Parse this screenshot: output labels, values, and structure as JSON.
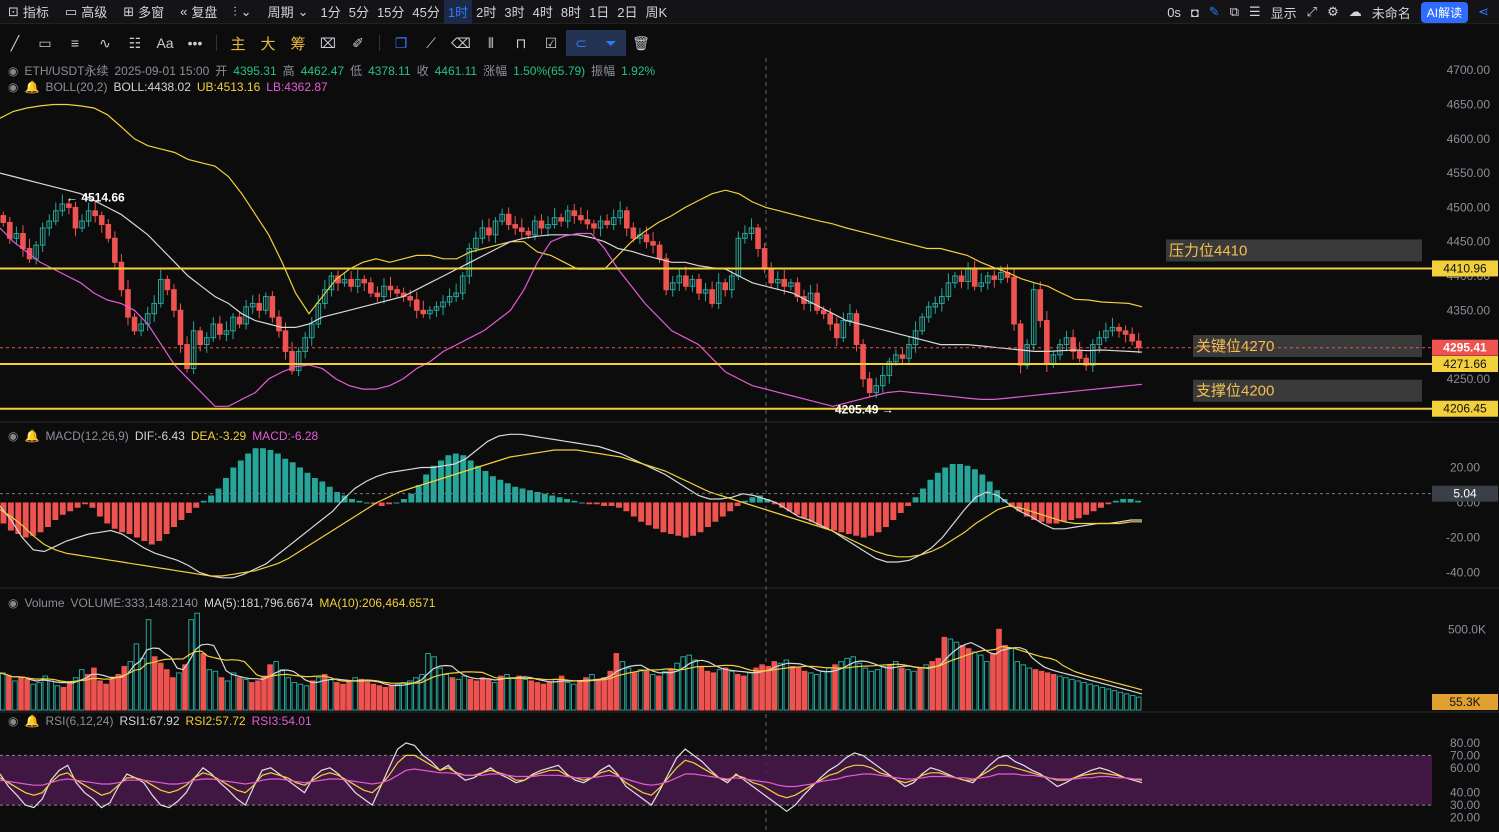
{
  "toolbar": {
    "indicators": "指标",
    "advanced": "高级",
    "multi_window": "多窗",
    "replay": "复盘",
    "period": "周期",
    "intervals": [
      "1分",
      "5分",
      "15分",
      "45分",
      "1时",
      "2时",
      "3时",
      "4时",
      "8时",
      "1日",
      "2日",
      "周K"
    ],
    "active_interval": "1时",
    "countdown": "0s",
    "display": "显示",
    "unnamed": "未命名",
    "ai_button": "AI解读"
  },
  "draw_tools": {
    "text_tool": "Aa",
    "more": "•••",
    "main": "主",
    "big": "大",
    "chips": "筹"
  },
  "legend": {
    "symbol": "ETH/USDT永续",
    "datetime": "2025-09-01 15:00",
    "open_label": "开",
    "open": "4395.31",
    "high_label": "高",
    "high": "4462.47",
    "low_label": "低",
    "low": "4378.11",
    "close_label": "收",
    "close": "4461.11",
    "change_label": "涨幅",
    "change": "1.50%(65.79)",
    "amp_label": "振幅",
    "amp": "1.92%",
    "boll_name": "BOLL(20,2)",
    "boll_mid": "BOLL:4438.02",
    "boll_ub": "UB:4513.16",
    "boll_lb": "LB:4362.87",
    "macd_name": "MACD(12,26,9)",
    "dif": "DIF:-6.43",
    "dea": "DEA:-3.29",
    "macd_val": "MACD:-6.28",
    "vol_name": "Volume",
    "vol_val": "VOLUME:333,148.2140",
    "vol_ma5": "MA(5):181,796.6674",
    "vol_ma10": "MA(10):206,464.6571",
    "rsi_name": "RSI(6,12,24)",
    "rsi1": "RSI1:67.92",
    "rsi2": "RSI2:57.72",
    "rsi3": "RSI3:54.01"
  },
  "colors": {
    "up": "#26a69a",
    "down": "#ef5350",
    "boll_mid": "#d8d8d8",
    "boll_ub": "#f2d03b",
    "boll_lb": "#e55bd4",
    "level_line": "#f2d03b",
    "rsi_band": "#4a1a4d"
  },
  "chart_data": {
    "type": "candlestick",
    "x_axis": "time (1h candles)",
    "price_axis": {
      "ticks": [
        4250,
        4300,
        4350,
        4400,
        4450,
        4500,
        4550,
        4600,
        4650,
        4700
      ],
      "tick_labels": [
        "4250.00",
        "4300.00",
        "4350.00",
        "4400.00",
        "4450.00",
        "4500.00",
        "4550.00",
        "4600.00",
        "4650.00",
        "4700.00"
      ]
    },
    "price_extremes": {
      "high": 4514.66,
      "high_label": "4514.66",
      "low": 4205.49,
      "low_label": "4205.49"
    },
    "last_price": 4295.41,
    "last_price_label": "4295.41",
    "level_labels": {
      "resistance": "4410.96",
      "key": "4271.66",
      "support": "4206.45"
    },
    "annotations": [
      {
        "text": "压力位4410",
        "price": 4410.96
      },
      {
        "text": "关键位4270",
        "price": 4271.66
      },
      {
        "text": "支撑位4200",
        "price": 4206.45
      }
    ],
    "close": [
      4478,
      4455,
      4462,
      4440,
      4425,
      4445,
      4470,
      4480,
      4495,
      4505,
      4500,
      4470,
      4480,
      4495,
      4488,
      4475,
      4455,
      4420,
      4380,
      4340,
      4320,
      4330,
      4345,
      4360,
      4395,
      4380,
      4350,
      4300,
      4265,
      4320,
      4300,
      4310,
      4330,
      4315,
      4320,
      4340,
      4330,
      4355,
      4360,
      4350,
      4370,
      4340,
      4320,
      4290,
      4262,
      4290,
      4310,
      4330,
      4360,
      4380,
      4400,
      4390,
      4395,
      4385,
      4395,
      4390,
      4375,
      4370,
      4385,
      4380,
      4375,
      4370,
      4365,
      4350,
      4345,
      4350,
      4355,
      4362,
      4370,
      4375,
      4400,
      4440,
      4455,
      4470,
      4460,
      4480,
      4490,
      4475,
      4470,
      4465,
      4460,
      4480,
      4470,
      4475,
      4485,
      4480,
      4495,
      4488,
      4482,
      4476,
      4470,
      4480,
      4475,
      4485,
      4495,
      4470,
      4455,
      4460,
      4450,
      4445,
      4425,
      4380,
      4390,
      4400,
      4385,
      4395,
      4375,
      4380,
      4360,
      4390,
      4380,
      4400,
      4455,
      4462,
      4470,
      4440,
      4410,
      4390,
      4395,
      4385,
      4390,
      4370,
      4360,
      4375,
      4350,
      4345,
      4330,
      4310,
      4335,
      4345,
      4300,
      4250,
      4230,
      4240,
      4255,
      4275,
      4285,
      4280,
      4300,
      4320,
      4340,
      4355,
      4360,
      4370,
      4390,
      4400,
      4392,
      4410,
      4385,
      4390,
      4400,
      4395,
      4405,
      4398,
      4330,
      4270,
      4300,
      4380,
      4335,
      4272,
      4285,
      4300,
      4310,
      4290,
      4280,
      4270,
      4300,
      4310,
      4320,
      4325,
      4320,
      4315,
      4305,
      4295.41
    ],
    "boll": {
      "ub": [
        4630,
        4640,
        4645,
        4648,
        4650,
        4650,
        4648,
        4645,
        4635,
        4618,
        4600,
        4590,
        4585,
        4580,
        4570,
        4565,
        4560,
        4545,
        4520,
        4490,
        4460,
        4420,
        4375,
        4345,
        4370,
        4395,
        4410,
        4420,
        4425,
        4420,
        4425,
        4430,
        4430,
        4425,
        4425,
        4435,
        4440,
        4445,
        4450,
        4450,
        4435,
        4430,
        4420,
        4410,
        4410,
        4410,
        4430,
        4450,
        4465,
        4478,
        4488,
        4500,
        4510,
        4520,
        4525,
        4520,
        4508,
        4500,
        4495,
        4490,
        4485,
        4480,
        4476,
        4470,
        4465,
        4460,
        4455,
        4450,
        4445,
        4440,
        4440,
        4435,
        4430,
        4420,
        4412,
        4405,
        4396,
        4390,
        4385,
        4375,
        4366,
        4365,
        4362,
        4361,
        4360,
        4355
      ],
      "mid": [
        4550,
        4545,
        4540,
        4535,
        4530,
        4525,
        4520,
        4510,
        4500,
        4490,
        4475,
        4460,
        4440,
        4420,
        4400,
        4385,
        4370,
        4360,
        4345,
        4335,
        4330,
        4325,
        4325,
        4330,
        4340,
        4345,
        4350,
        4355,
        4360,
        4365,
        4370,
        4380,
        4390,
        4400,
        4410,
        4420,
        4430,
        4440,
        4450,
        4455,
        4458,
        4460,
        4460,
        4460,
        4456,
        4450,
        4440,
        4436,
        4430,
        4425,
        4420,
        4420,
        4415,
        4412,
        4410,
        4400,
        4390,
        4385,
        4380,
        4375,
        4365,
        4355,
        4345,
        4335,
        4330,
        4325,
        4320,
        4315,
        4310,
        4305,
        4300,
        4300,
        4300,
        4298,
        4296,
        4294,
        4292,
        4290,
        4290,
        4291,
        4292,
        4291,
        4292,
        4291,
        4290,
        4289
      ],
      "lb": [
        4470,
        4450,
        4435,
        4420,
        4410,
        4400,
        4390,
        4375,
        4365,
        4360,
        4350,
        4330,
        4300,
        4270,
        4250,
        4230,
        4210,
        4210,
        4220,
        4230,
        4250,
        4260,
        4268,
        4270,
        4265,
        4250,
        4240,
        4235,
        4235,
        4240,
        4250,
        4265,
        4275,
        4290,
        4300,
        4310,
        4320,
        4335,
        4350,
        4380,
        4420,
        4450,
        4458,
        4462,
        4462,
        4440,
        4410,
        4385,
        4360,
        4340,
        4320,
        4310,
        4300,
        4280,
        4260,
        4250,
        4240,
        4235,
        4230,
        4225,
        4220,
        4215,
        4210,
        4215,
        4220,
        4225,
        4230,
        4232,
        4230,
        4228,
        4226,
        4224,
        4222,
        4220,
        4220,
        4222,
        4224,
        4226,
        4228,
        4230,
        4232,
        4234,
        4236,
        4238,
        4240,
        4242
      ]
    },
    "macd_axis": {
      "ticks": [
        20,
        0,
        -20,
        -40
      ],
      "tick_labels": [
        "20.00",
        "0.00",
        "-20.00",
        "-40.00"
      ],
      "current": 5.04,
      "current_label": "5.04"
    },
    "macd_hist": [
      -12,
      -16,
      -18,
      -20,
      -19,
      -17,
      -14,
      -10,
      -7,
      -5,
      -3,
      -1,
      -3,
      -8,
      -12,
      -15,
      -17,
      -18,
      -20,
      -22,
      -24,
      -22,
      -18,
      -14,
      -10,
      -6,
      -3,
      1,
      4,
      8,
      14,
      20,
      24,
      28,
      31,
      31,
      30,
      28,
      25,
      23,
      20,
      17,
      14,
      12,
      9,
      6,
      4,
      2,
      1,
      0,
      -1,
      -2,
      -1,
      0,
      2,
      5,
      10,
      16,
      21,
      24,
      27,
      28,
      27,
      24,
      21,
      18,
      15,
      13,
      11,
      9,
      8,
      7,
      6,
      5,
      4,
      3,
      2,
      1,
      0,
      -1,
      -1,
      -2,
      -2,
      -3,
      -5,
      -8,
      -11,
      -13,
      -15,
      -17,
      -18,
      -19,
      -20,
      -19,
      -17,
      -14,
      -11,
      -8,
      -5,
      -2,
      1,
      3,
      4,
      2,
      -1,
      -3,
      -5,
      -7,
      -9,
      -11,
      -13,
      -15,
      -16,
      -17,
      -18,
      -19,
      -20,
      -19,
      -17,
      -14,
      -10,
      -6,
      -2,
      3,
      8,
      13,
      17,
      20,
      22,
      22,
      21,
      19,
      16,
      12,
      7,
      2,
      -2,
      -5,
      -8,
      -10,
      -11,
      -12,
      -12,
      -11,
      -10,
      -9,
      -7,
      -5,
      -3,
      -1,
      1,
      2,
      2,
      1
    ],
    "macd_dif": [
      -2,
      -10,
      -20,
      -27,
      -28,
      -25,
      -22,
      -20,
      -18,
      -17,
      -16,
      -18,
      -22,
      -26,
      -29,
      -31,
      -33,
      -36,
      -40,
      -42,
      -43,
      -43,
      -41,
      -38,
      -35,
      -30,
      -25,
      -20,
      -15,
      -10,
      -5,
      2,
      8,
      12,
      15,
      17,
      18,
      19,
      20,
      20,
      21,
      22,
      25,
      30,
      35,
      38,
      39,
      39,
      38,
      37,
      36,
      35,
      34,
      33,
      32,
      30,
      28,
      25,
      22,
      19,
      16,
      12,
      8,
      4,
      2,
      2,
      3,
      5,
      4,
      2,
      0,
      -4,
      -8,
      -10,
      -13,
      -16,
      -20,
      -24,
      -28,
      -32,
      -34,
      -34,
      -33,
      -30,
      -26,
      -20,
      -12,
      -4,
      3,
      6,
      4,
      -1,
      -5,
      -8,
      -12,
      -15,
      -15,
      -14,
      -13,
      -12,
      -12,
      -11,
      -10,
      -10
    ],
    "macd_dea": [
      -4,
      -8,
      -13,
      -19,
      -24,
      -27,
      -29,
      -30,
      -31,
      -32,
      -33,
      -34,
      -35,
      -36,
      -37,
      -38,
      -39,
      -40,
      -41,
      -42,
      -42,
      -41,
      -40,
      -39,
      -37,
      -35,
      -32,
      -28,
      -24,
      -20,
      -16,
      -12,
      -8,
      -4,
      0,
      3,
      6,
      8,
      10,
      12,
      14,
      16,
      18,
      20,
      22,
      24,
      26,
      27,
      28,
      29,
      30,
      30,
      30,
      29,
      28,
      27,
      26,
      24,
      22,
      20,
      18,
      15,
      12,
      9,
      6,
      4,
      2,
      0,
      -2,
      -4,
      -6,
      -8,
      -10,
      -12,
      -14,
      -16,
      -19,
      -22,
      -25,
      -28,
      -30,
      -31,
      -31,
      -30,
      -28,
      -25,
      -21,
      -17,
      -12,
      -8,
      -4,
      -2,
      -3,
      -5,
      -7,
      -9,
      -11,
      -12,
      -12,
      -12,
      -12,
      -12,
      -11,
      -11
    ],
    "volume_axis": {
      "ticks": [
        500000
      ],
      "tick_labels": [
        "500.0K"
      ],
      "current_label": "55.3K"
    },
    "volume": [
      230,
      210,
      180,
      200,
      190,
      160,
      170,
      210,
      180,
      150,
      140,
      170,
      200,
      250,
      220,
      260,
      180,
      160,
      190,
      220,
      270,
      300,
      410,
      320,
      560,
      330,
      290,
      250,
      200,
      230,
      280,
      560,
      600,
      350,
      250,
      240,
      200,
      180,
      230,
      200,
      190,
      170,
      180,
      210,
      280,
      300,
      250,
      200,
      170,
      160,
      150,
      180,
      200,
      220,
      190,
      170,
      160,
      180,
      200,
      190,
      170,
      160,
      150,
      140,
      150,
      160,
      170,
      180,
      200,
      220,
      350,
      330,
      260,
      220,
      200,
      190,
      210,
      190,
      180,
      200,
      190,
      170,
      210,
      220,
      200,
      210,
      190,
      180,
      170,
      160,
      170,
      190,
      210,
      170,
      160,
      180,
      200,
      220,
      190,
      200,
      240,
      350,
      300,
      260,
      230,
      250,
      240,
      220,
      210,
      240,
      250,
      290,
      330,
      340,
      310,
      270,
      240,
      230,
      250,
      260,
      240,
      220,
      210,
      230,
      260,
      280,
      270,
      300,
      290,
      310,
      270,
      260,
      240,
      230,
      220,
      240,
      260,
      280,
      300,
      320,
      330,
      290,
      260,
      240,
      250,
      270,
      280,
      300,
      260,
      250,
      240,
      260,
      280,
      300,
      320,
      450,
      440,
      420,
      400,
      380,
      360,
      340,
      300,
      350,
      500,
      400,
      380,
      300,
      280,
      260,
      250,
      240,
      230,
      220,
      210,
      200,
      190,
      180,
      170,
      160,
      150,
      140,
      130,
      120,
      110,
      100,
      90,
      80
    ],
    "rsi_axis": {
      "ticks": [
        80,
        70,
        60,
        40,
        30,
        20
      ],
      "tick_labels": [
        "80.00",
        "70.00",
        "60.00",
        "40.00",
        "30.00",
        "20.00"
      ],
      "band": [
        30,
        70
      ]
    },
    "rsi1": [
      55,
      45,
      38,
      30,
      28,
      35,
      50,
      58,
      62,
      48,
      40,
      35,
      28,
      32,
      45,
      55,
      52,
      48,
      38,
      30,
      28,
      33,
      40,
      52,
      60,
      55,
      48,
      42,
      35,
      30,
      45,
      58,
      60,
      55,
      50,
      45,
      40,
      52,
      58,
      60,
      55,
      48,
      40,
      35,
      30,
      45,
      60,
      75,
      80,
      78,
      70,
      65,
      58,
      62,
      55,
      50,
      52,
      56,
      60,
      55,
      52,
      48,
      50,
      55,
      58,
      60,
      62,
      55,
      50,
      48,
      52,
      58,
      62,
      55,
      45,
      40,
      35,
      30,
      42,
      55,
      68,
      75,
      70,
      65,
      58,
      52,
      48,
      55,
      50,
      45,
      40,
      35,
      30,
      25,
      30,
      38,
      45,
      52,
      58,
      62,
      68,
      72,
      70,
      65,
      60,
      55,
      50,
      45,
      48,
      55,
      60,
      58,
      55,
      52,
      50,
      48,
      55,
      62,
      68,
      70,
      65,
      62,
      58,
      55,
      50,
      45,
      48,
      52,
      55,
      58,
      60,
      58,
      55,
      52,
      50,
      48
    ],
    "rsi2": [
      52,
      48,
      44,
      40,
      38,
      40,
      48,
      54,
      56,
      50,
      46,
      42,
      38,
      40,
      46,
      52,
      52,
      50,
      46,
      42,
      40,
      42,
      46,
      52,
      56,
      54,
      50,
      46,
      42,
      40,
      46,
      54,
      56,
      54,
      52,
      48,
      46,
      50,
      54,
      56,
      54,
      50,
      46,
      42,
      40,
      46,
      54,
      64,
      70,
      70,
      66,
      62,
      58,
      60,
      56,
      54,
      54,
      56,
      58,
      56,
      54,
      50,
      50,
      54,
      56,
      58,
      58,
      54,
      52,
      50,
      52,
      56,
      58,
      54,
      48,
      44,
      40,
      38,
      44,
      52,
      60,
      66,
      64,
      60,
      56,
      52,
      50,
      54,
      52,
      48,
      46,
      42,
      38,
      36,
      38,
      42,
      46,
      50,
      54,
      56,
      60,
      62,
      62,
      60,
      56,
      54,
      50,
      48,
      50,
      54,
      56,
      56,
      54,
      52,
      50,
      50,
      54,
      58,
      62,
      62,
      60,
      58,
      56,
      54,
      52,
      50,
      50,
      52,
      54,
      55,
      56,
      55,
      54,
      52,
      51,
      50
    ],
    "rsi3": [
      50,
      49,
      48,
      47,
      46,
      46,
      48,
      50,
      51,
      50,
      49,
      48,
      47,
      47,
      48,
      50,
      50,
      50,
      49,
      48,
      47,
      47,
      48,
      50,
      51,
      51,
      50,
      49,
      48,
      47,
      48,
      50,
      51,
      51,
      50,
      49,
      48,
      49,
      50,
      51,
      51,
      50,
      49,
      48,
      47,
      48,
      50,
      54,
      58,
      59,
      58,
      57,
      56,
      56,
      55,
      54,
      54,
      54,
      55,
      55,
      54,
      53,
      53,
      53,
      54,
      54,
      54,
      53,
      52,
      52,
      52,
      53,
      54,
      53,
      51,
      49,
      47,
      46,
      47,
      49,
      52,
      55,
      55,
      54,
      53,
      52,
      51,
      52,
      51,
      50,
      49,
      48,
      46,
      45,
      45,
      46,
      47,
      49,
      50,
      51,
      53,
      54,
      55,
      55,
      54,
      53,
      52,
      51,
      51,
      52,
      53,
      53,
      53,
      52,
      52,
      51,
      52,
      53,
      55,
      55,
      55,
      54,
      54,
      53,
      52,
      51,
      51,
      51,
      52,
      52,
      53,
      53,
      52,
      52,
      51,
      51
    ]
  }
}
